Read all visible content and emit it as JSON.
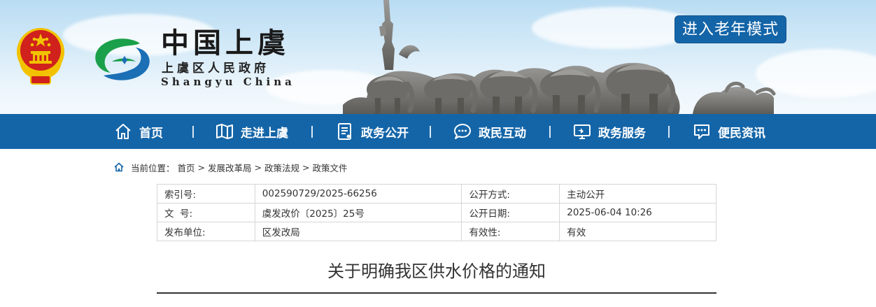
{
  "header": {
    "brand_cn": "中国上虞",
    "brand_sub": "上虞区人民政府",
    "brand_en": "Shangyu China",
    "elder_mode_label": "进入老年模式"
  },
  "nav": {
    "items": [
      {
        "label": "首页",
        "icon": "home-icon"
      },
      {
        "label": "走进上虞",
        "icon": "map-icon"
      },
      {
        "label": "政务公开",
        "icon": "document-icon"
      },
      {
        "label": "政民互动",
        "icon": "chat-icon"
      },
      {
        "label": "政务服务",
        "icon": "monitor-icon"
      },
      {
        "label": "便民资讯",
        "icon": "message-icon"
      }
    ],
    "separator": "|"
  },
  "breadcrumb": {
    "prefix": "当前位置：",
    "items": [
      "首页",
      "发展改革局",
      "政策法规",
      "政策文件"
    ],
    "sep": ">"
  },
  "meta": {
    "rows": [
      {
        "k1": "索引号:",
        "v1": "002590729/2025-66256",
        "k2": "公开方式:",
        "v2": "主动公开"
      },
      {
        "k1": "文  号:",
        "v1": "虞发改价〔2025〕25号",
        "k2": "公开日期:",
        "v2": "2025-06-04 10:26"
      },
      {
        "k1": "发布单位:",
        "v1": "区发改局",
        "k2": "有效性:",
        "v2": "有效"
      }
    ]
  },
  "document": {
    "title": "关于明确我区供水价格的通知"
  },
  "colors": {
    "nav_blue": "#1465a8",
    "emblem_red": "#d0211c",
    "emblem_gold": "#f2c200",
    "logo_green": "#1aa04a",
    "logo_blue": "#1b6fb5"
  }
}
